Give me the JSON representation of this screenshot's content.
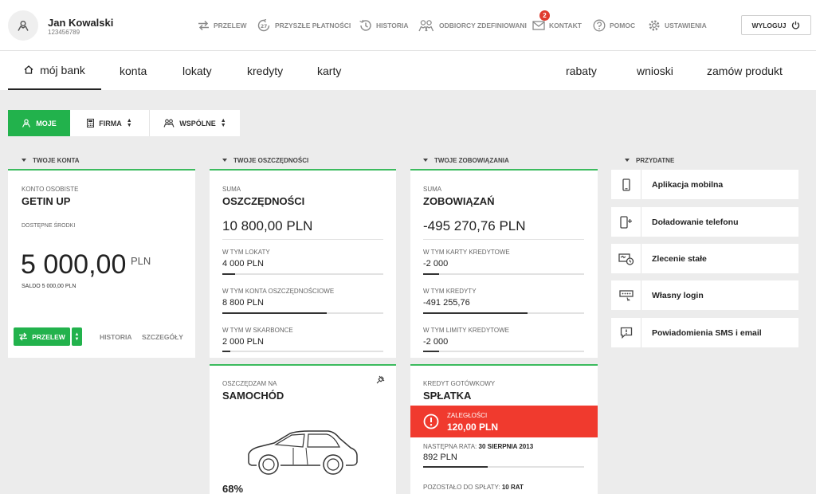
{
  "user": {
    "name": "Jan Kowalski",
    "id": "123456789"
  },
  "topnav": {
    "przelew": "PRZELEW",
    "przyszle": "PRZYSZŁE PŁATNOŚCI",
    "historia": "HISTORIA",
    "odbiorcy": "ODBIORCY ZDEFINIOWANI",
    "kontakt": "KONTAKT",
    "kontakt_badge": "2",
    "pomoc": "POMOC",
    "ustawienia": "USTAWIENIA",
    "logout": "WYLOGUJ"
  },
  "mainnav": {
    "moj_bank": "mój bank",
    "konta": "konta",
    "lokaty": "lokaty",
    "kredyty": "kredyty",
    "karty": "karty",
    "rabaty": "rabaty",
    "wnioski": "wnioski",
    "zamow": "zamów produkt"
  },
  "filters": {
    "moje": "MOJE",
    "firma": "FIRMA",
    "wspolne": "WSPÓLNE"
  },
  "accounts": {
    "header": "TWOJE KONTA",
    "type_label": "KONTO OSOBISTE",
    "name": "GETIN UP",
    "available_label": "DOSTĘPNE ŚRODKI",
    "amount": "5 000,00",
    "currency": "PLN",
    "balance": "SALDO 5 000,00 PLN",
    "przelew_btn": "PRZELEW",
    "historia": "HISTORIA",
    "szczegoly": "SZCZEGÓŁY"
  },
  "savings": {
    "header": "TWOJE OSZCZĘDNOŚCI",
    "sum_label": "SUMA",
    "title": "OSZCZĘDNOŚCI",
    "total": "10 800,00 PLN",
    "items": [
      {
        "label": "W TYM LOKATY",
        "value": "4 000 PLN",
        "fill": 0.08
      },
      {
        "label": "W TYM KONTA OSZCZĘDNOŚCIOWE",
        "value": "8 800 PLN",
        "fill": 0.65
      },
      {
        "label": "W TYM W SKARBONCE",
        "value": "2 000 PLN",
        "fill": 0.05
      }
    ],
    "goal_label": "OSZCZĘDZAM NA",
    "goal_title": "SAMOCHÓD",
    "goal_progress": "68%",
    "goal_fill": 0.68
  },
  "liabilities": {
    "header": "TWOJE ZOBOWIĄZANIA",
    "sum_label": "SUMA",
    "title": "ZOBOWIĄZAŃ",
    "total": "-495 270,76 PLN",
    "items": [
      {
        "label": "W TYM KARTY KREDYTOWE",
        "value": "-2 000",
        "fill": 0.1
      },
      {
        "label": "W TYM KREDYTY",
        "value": "-491 255,76",
        "fill": 0.65
      },
      {
        "label": "W TYM LIMITY KREDYTOWE",
        "value": "-2 000",
        "fill": 0.1
      }
    ],
    "loan_label": "KREDYT GOTÓWKOWY",
    "loan_title": "SPŁATKA",
    "overdue_label": "ZALEGŁOŚCI",
    "overdue_value": "120,00 PLN",
    "next_label": "NASTĘPNA RATA:",
    "next_date": "30 SIERPNIA 2013",
    "next_value": "892 PLN",
    "next_fill": 0.4,
    "remaining_label": "POZOSTAŁO DO SPŁATY:",
    "remaining_value": "10 RAT"
  },
  "useful": {
    "header": "PRZYDATNE",
    "items": [
      {
        "label": "Aplikacja mobilna",
        "icon": "mobile-phone-icon"
      },
      {
        "label": "Doładowanie telefonu",
        "icon": "phone-topup-icon"
      },
      {
        "label": "Zlecenie stałe",
        "icon": "standing-order-icon"
      },
      {
        "label": "Własny login",
        "icon": "login-keyboard-icon"
      },
      {
        "label": "Powiadomienia SMS i email",
        "icon": "notification-icon"
      }
    ]
  },
  "colors": {
    "accent": "#22b24c",
    "alert": "#f03a2e",
    "card_border": "#3cbb5e"
  }
}
